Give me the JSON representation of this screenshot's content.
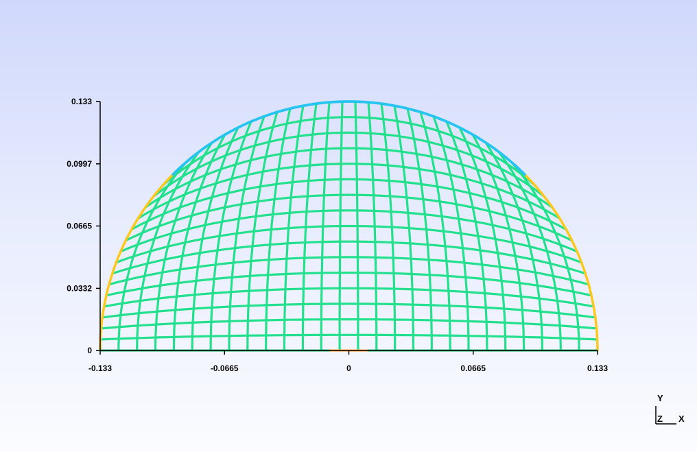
{
  "plot": {
    "x_range": [
      -0.133,
      0.133
    ],
    "y_range": [
      0,
      0.133
    ],
    "x_ticks": [
      {
        "value": -0.133,
        "label": "-0.133"
      },
      {
        "value": -0.0665,
        "label": "-0.0665"
      },
      {
        "value": 0,
        "label": "0"
      },
      {
        "value": 0.0665,
        "label": "0.0665"
      },
      {
        "value": 0.133,
        "label": "0.133"
      }
    ],
    "y_ticks": [
      {
        "value": 0,
        "label": "0"
      },
      {
        "value": 0.0332,
        "label": "0.0332"
      },
      {
        "value": 0.0665,
        "label": "0.0665"
      },
      {
        "value": 0.0997,
        "label": "0.0997"
      },
      {
        "value": 0.133,
        "label": "0.133"
      }
    ]
  },
  "mesh": {
    "shape": "half-disk",
    "radius": 0.133,
    "horizontal_line_count": 16,
    "vertical_line_count": 27,
    "colors": {
      "grid": "#22e08c",
      "top_boundary": "#26c4f0",
      "side_boundary": "#ffc81c",
      "base_boundary": "#20b26a",
      "base_center_marker": "#ff9a2a",
      "axes": "#000000"
    }
  },
  "triad": {
    "y_label": "Y",
    "z_label": "Z",
    "x_label": "X"
  }
}
